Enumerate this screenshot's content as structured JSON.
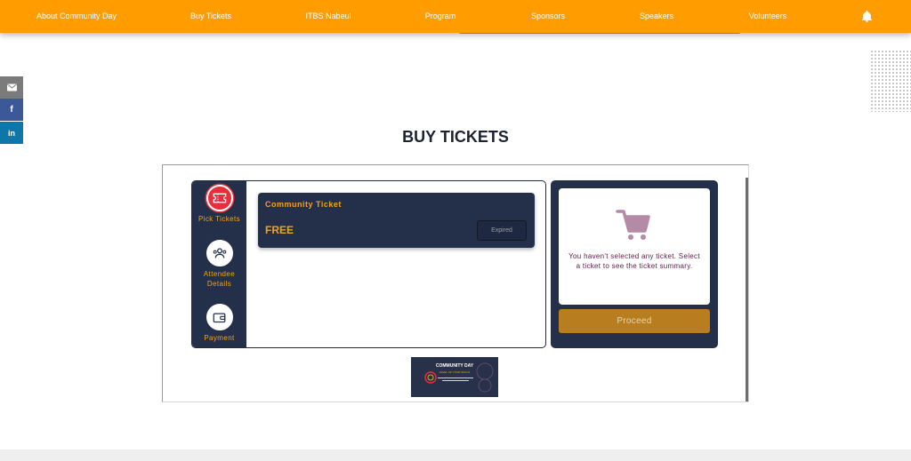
{
  "nav": {
    "items": [
      {
        "label": "About Community Day"
      },
      {
        "label": "Buy Tickets"
      },
      {
        "label": "ITBS Nabeul"
      },
      {
        "label": "Program"
      },
      {
        "label": "Sponsors"
      },
      {
        "label": "Speakers"
      },
      {
        "label": "Volunteers"
      }
    ],
    "bell_icon": "bell-icon"
  },
  "share": {
    "email_icon": "email-icon",
    "facebook_icon": "facebook-icon",
    "facebook_glyph": "f",
    "linkedin_icon": "linkedin-icon",
    "linkedin_glyph": "in"
  },
  "page": {
    "title": "BUY TICKETS"
  },
  "steps": [
    {
      "label": "Pick Tickets",
      "icon": "ticket-icon",
      "active": true
    },
    {
      "label": "Attendee Details",
      "icon": "attendees-icon",
      "active": false
    },
    {
      "label": "Payment",
      "icon": "wallet-icon",
      "active": false
    }
  ],
  "ticket": {
    "name": "Community Ticket",
    "price": "FREE",
    "status": "Expired"
  },
  "summary": {
    "empty_message": "You haven't selected any ticket. Select a ticket to see the ticket summary.",
    "proceed_label": "Proceed",
    "cart_icon": "cart-icon"
  },
  "banner": {
    "title": "COMMUNITY DAY",
    "subtitle": "LEVEL UP YOUR SKILLS"
  },
  "colors": {
    "nav": "#ff9d00",
    "navy": "#243049",
    "accent": "#f2a21b",
    "proceed": "#b87d1e",
    "active_step": "#e62e3c"
  }
}
